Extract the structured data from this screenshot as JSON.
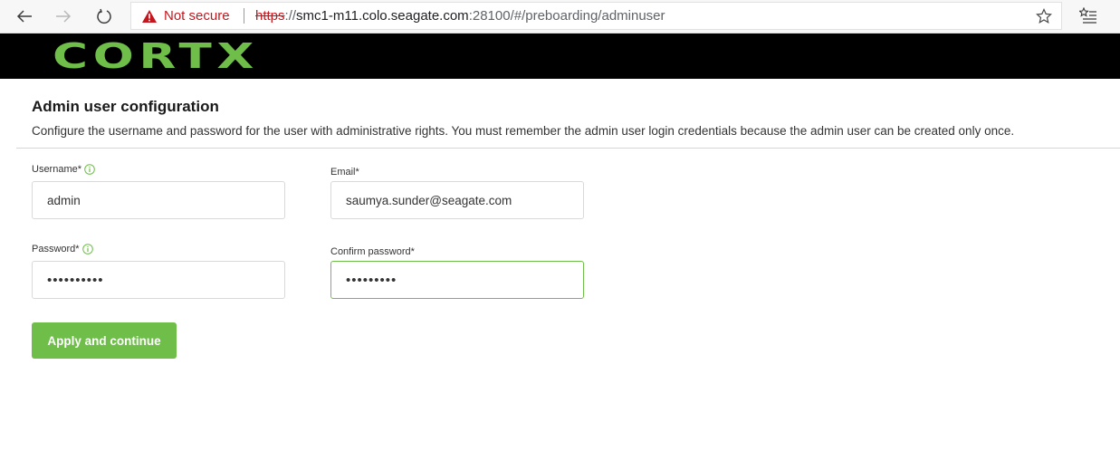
{
  "browser": {
    "security_label": "Not secure",
    "url_scheme": "https",
    "url_host": "smc1-m11.colo.seagate.com",
    "url_rest": ":28100/#/preboarding/adminuser",
    "icons": [
      "back-arrow-icon",
      "forward-arrow-icon",
      "reload-icon",
      "warning-icon",
      "star-icon",
      "reading-list-icon"
    ]
  },
  "header": {
    "logo_text": "CORTX",
    "logo_color": "#6ebe49",
    "background": "#000000"
  },
  "page": {
    "title": "Admin user configuration",
    "description": "Configure the username and password for the user with administrative rights. You must remember the admin user login credentials because the admin user can be created only once."
  },
  "form": {
    "username_label": "Username*",
    "username_value": "admin",
    "email_label": "Email*",
    "email_value": "saumya.sunder@seagate.com",
    "password_label": "Password*",
    "password_value": "••••••••••",
    "confirm_label": "Confirm password*",
    "confirm_value": "•••••••••",
    "submit_label": "Apply and continue",
    "accent_color": "#6ebe49"
  }
}
